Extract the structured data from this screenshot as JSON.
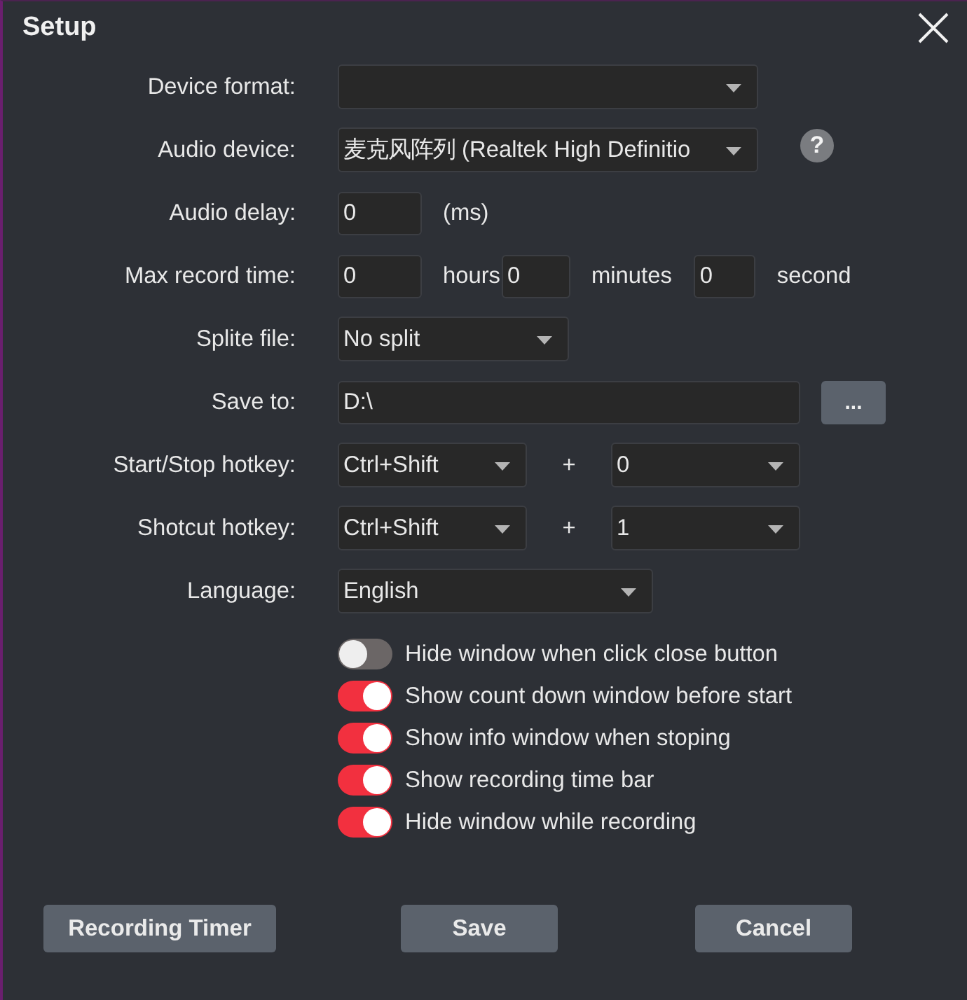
{
  "window": {
    "title": "Setup"
  },
  "rows": [
    {
      "label": "Device format:",
      "controls": [
        {
          "kind": "dropdown"
        }
      ]
    },
    {
      "label": "Audio device:",
      "controls": [
        {
          "kind": "dropdown",
          "value": "麦克风阵列 (Realtek High Definitio"
        },
        {
          "kind": "help",
          "text": "?"
        }
      ]
    },
    {
      "label": "Audio delay:",
      "controls": [
        {
          "kind": "input",
          "value": "0"
        },
        {
          "kind": "text",
          "text": "(ms)"
        }
      ]
    },
    {
      "label": "Max record time:",
      "controls": [
        {
          "kind": "input",
          "value": "0"
        },
        {
          "kind": "text",
          "text": "hours"
        },
        {
          "kind": "input",
          "value": "0"
        },
        {
          "kind": "text",
          "text": "minutes"
        },
        {
          "kind": "input",
          "value": "0"
        },
        {
          "kind": "text",
          "text": "second"
        }
      ]
    },
    {
      "label": "Splite file:",
      "controls": [
        {
          "kind": "dropdown",
          "value": "No split"
        }
      ]
    },
    {
      "label": "Save to:",
      "controls": [
        {
          "kind": "input",
          "value": "D:\\"
        },
        {
          "kind": "button",
          "text": "..."
        }
      ]
    },
    {
      "label": "Start/Stop hotkey:",
      "controls": [
        {
          "kind": "dropdown",
          "value": "Ctrl+Shift"
        },
        {
          "kind": "plus",
          "text": "+"
        },
        {
          "kind": "dropdown",
          "value": "0"
        }
      ]
    },
    {
      "label": "Shotcut hotkey:",
      "controls": [
        {
          "kind": "dropdown",
          "value": "Ctrl+Shift"
        },
        {
          "kind": "plus",
          "text": "+"
        },
        {
          "kind": "dropdown",
          "value": "1"
        }
      ]
    },
    {
      "label": "Language:",
      "controls": [
        {
          "kind": "dropdown",
          "value": "English"
        }
      ]
    }
  ],
  "toggles": [
    {
      "label": "Hide window when click close button",
      "on": false
    },
    {
      "label": "Show count down window before start",
      "on": true
    },
    {
      "label": "Show info window when stoping",
      "on": true
    },
    {
      "label": "Show recording time bar",
      "on": true
    },
    {
      "label": "Hide window while recording",
      "on": true
    }
  ],
  "buttons": [
    "Recording Timer",
    "Save",
    "Cancel"
  ]
}
